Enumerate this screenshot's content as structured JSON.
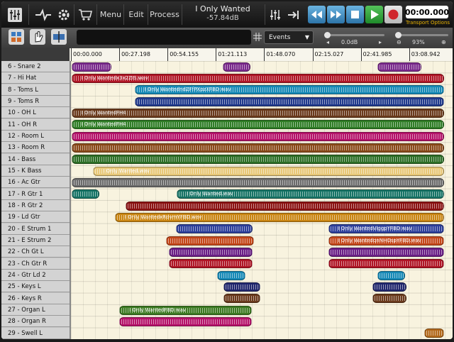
{
  "topbar": {
    "menu_labels": [
      "Menu",
      "Edit",
      "Process"
    ],
    "song_title": "I Only Wanted",
    "song_level": "-57.84dB",
    "time": "00:00.000",
    "transport_options": "Transport Options"
  },
  "toolbar": {
    "view_select": "Events",
    "volume_label": "0.0dB",
    "zoom_label": "93%"
  },
  "ruler": {
    "labels": [
      "00:00.000",
      "00:27.198",
      "00:54.155",
      "01:21.113",
      "01:48.070",
      "02:15.027",
      "02:41.985",
      "03:08.942"
    ]
  },
  "tracks": [
    {
      "name": "6 - Snare 2"
    },
    {
      "name": "7 - Hi Hat"
    },
    {
      "name": "8 - Toms L"
    },
    {
      "name": "9 - Toms R"
    },
    {
      "name": "10 - OH L"
    },
    {
      "name": "11 - OH R"
    },
    {
      "name": "12 - Room L"
    },
    {
      "name": "13 - Room R"
    },
    {
      "name": "14 - Bass"
    },
    {
      "name": "15 - K Bass"
    },
    {
      "name": "16 - Ac Gtr"
    },
    {
      "name": "17 - R Gtr 1"
    },
    {
      "name": "18 - R Gtr 2"
    },
    {
      "name": "19 - Ld Gtr"
    },
    {
      "name": "20 - E Strum 1"
    },
    {
      "name": "21 - E Strum 2"
    },
    {
      "name": "22 - Ch Gt L"
    },
    {
      "name": "23 - Ch Gtr R"
    },
    {
      "name": "24 - Gtr Ld 2"
    },
    {
      "name": "25 - Keys L"
    },
    {
      "name": "26 - Keys R"
    },
    {
      "name": "27 - Organ L"
    },
    {
      "name": "28 - Organ R"
    },
    {
      "name": "29 - Swell L"
    }
  ],
  "clips": [
    {
      "track": 0,
      "start": 0.4,
      "end": 22.5,
      "color": "#7a2a8c"
    },
    {
      "track": 0,
      "start": 84.5,
      "end": 100.0,
      "color": "#7a2a8c"
    },
    {
      "track": 0,
      "start": 171.0,
      "end": 195.5,
      "color": "#7a2a8c"
    },
    {
      "track": 1,
      "start": 0.3,
      "end": 208.0,
      "color": "#b01626",
      "label": "I Only Wantedx3x2ZIS.wav"
    },
    {
      "track": 2,
      "start": 35.5,
      "end": 208.0,
      "color": "#1689b6",
      "label": "I Only WantedndZFfPXpzXFBD.wav"
    },
    {
      "track": 3,
      "start": 35.5,
      "end": 208.0,
      "color": "#213a8c"
    },
    {
      "track": 4,
      "start": 0.3,
      "end": 208.0,
      "color": "#6a3a1c",
      "label": "I Only WantedFH4"
    },
    {
      "track": 5,
      "start": 0.3,
      "end": 208.0,
      "color": "#2f7d26",
      "label": "I Only WantedFH4"
    },
    {
      "track": 6,
      "start": 0.3,
      "end": 208.0,
      "color": "#b5136a"
    },
    {
      "track": 7,
      "start": 0.3,
      "end": 208.0,
      "color": "#8a4a1a"
    },
    {
      "track": 8,
      "start": 0.3,
      "end": 208.0,
      "color": "#2d6e26"
    },
    {
      "track": 9,
      "start": 12.4,
      "end": 208.0,
      "color": "#e8c878",
      "label": "I Only Wanted.wav"
    },
    {
      "track": 10,
      "start": 0.3,
      "end": 208.0,
      "color": "#6b6b6b"
    },
    {
      "track": 11,
      "start": 0.3,
      "end": 16.0,
      "color": "#177466"
    },
    {
      "track": 11,
      "start": 59.0,
      "end": 208.0,
      "color": "#177466",
      "label": "I Only Wanted.wav"
    },
    {
      "track": 12,
      "start": 30.5,
      "end": 208.0,
      "color": "#8c1414"
    },
    {
      "track": 13,
      "start": 24.5,
      "end": 208.0,
      "color": "#c98512",
      "label": "I Only WantedxRdvmYFBD.wav"
    },
    {
      "track": 14,
      "start": 58.5,
      "end": 101.5,
      "color": "#2d3f9a"
    },
    {
      "track": 14,
      "start": 143.5,
      "end": 208.0,
      "color": "#2d3f9a",
      "label": "I Only WantedViggpYFBD.wav"
    },
    {
      "track": 15,
      "start": 53.0,
      "end": 102.0,
      "color": "#c4471a"
    },
    {
      "track": 15,
      "start": 143.5,
      "end": 208.0,
      "color": "#c4471a",
      "label": "I Only WantedqnNHOspYFBD.wav"
    },
    {
      "track": 16,
      "start": 54.5,
      "end": 101.5,
      "color": "#6a1f86"
    },
    {
      "track": 16,
      "start": 143.5,
      "end": 208.0,
      "color": "#6a1f86"
    },
    {
      "track": 17,
      "start": 54.5,
      "end": 101.5,
      "color": "#b01626"
    },
    {
      "track": 17,
      "start": 143.5,
      "end": 208.0,
      "color": "#b01626"
    },
    {
      "track": 18,
      "start": 81.5,
      "end": 97.5,
      "color": "#1689b6"
    },
    {
      "track": 18,
      "start": 171.0,
      "end": 186.5,
      "color": "#1689b6"
    },
    {
      "track": 19,
      "start": 85.0,
      "end": 105.5,
      "color": "#22286e"
    },
    {
      "track": 19,
      "start": 168.0,
      "end": 187.0,
      "color": "#22286e"
    },
    {
      "track": 20,
      "start": 85.0,
      "end": 105.5,
      "color": "#6a3a1c"
    },
    {
      "track": 20,
      "start": 168.0,
      "end": 187.0,
      "color": "#6a3a1c"
    },
    {
      "track": 21,
      "start": 27.0,
      "end": 101.0,
      "color": "#3c7a22",
      "label": "I Only WantedFBD.wav"
    },
    {
      "track": 22,
      "start": 27.0,
      "end": 101.0,
      "color": "#b5136a"
    },
    {
      "track": 23,
      "start": 197.0,
      "end": 208.0,
      "color": "#b36a1c"
    }
  ]
}
